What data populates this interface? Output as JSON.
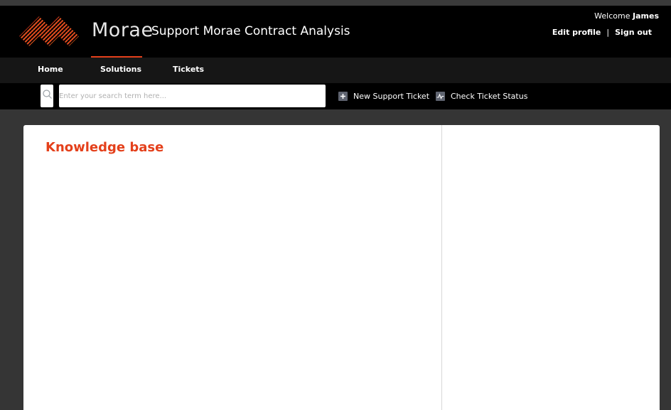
{
  "brand": {
    "logo_text": "Morae",
    "portal_title": "Support Morae Contract Analysis",
    "accent_color": "#e4401b",
    "logo_colors": [
      "#f5a623",
      "#e4401b",
      "#c0392b"
    ]
  },
  "user": {
    "welcome_prefix": "Welcome",
    "name": "James",
    "edit_profile": "Edit profile",
    "separator": "|",
    "sign_out": "Sign out"
  },
  "nav": {
    "items": [
      {
        "label": "Home",
        "active": false
      },
      {
        "label": "Solutions",
        "active": true
      },
      {
        "label": "Tickets",
        "active": false
      }
    ]
  },
  "search": {
    "placeholder": "Enter your search term here...",
    "value": "",
    "icon": "search-icon"
  },
  "actions": [
    {
      "label": "New Support Ticket",
      "icon": "plus-icon"
    },
    {
      "label": "Check Ticket Status",
      "icon": "activity-chart-icon"
    }
  ],
  "main": {
    "heading": "Knowledge base"
  }
}
